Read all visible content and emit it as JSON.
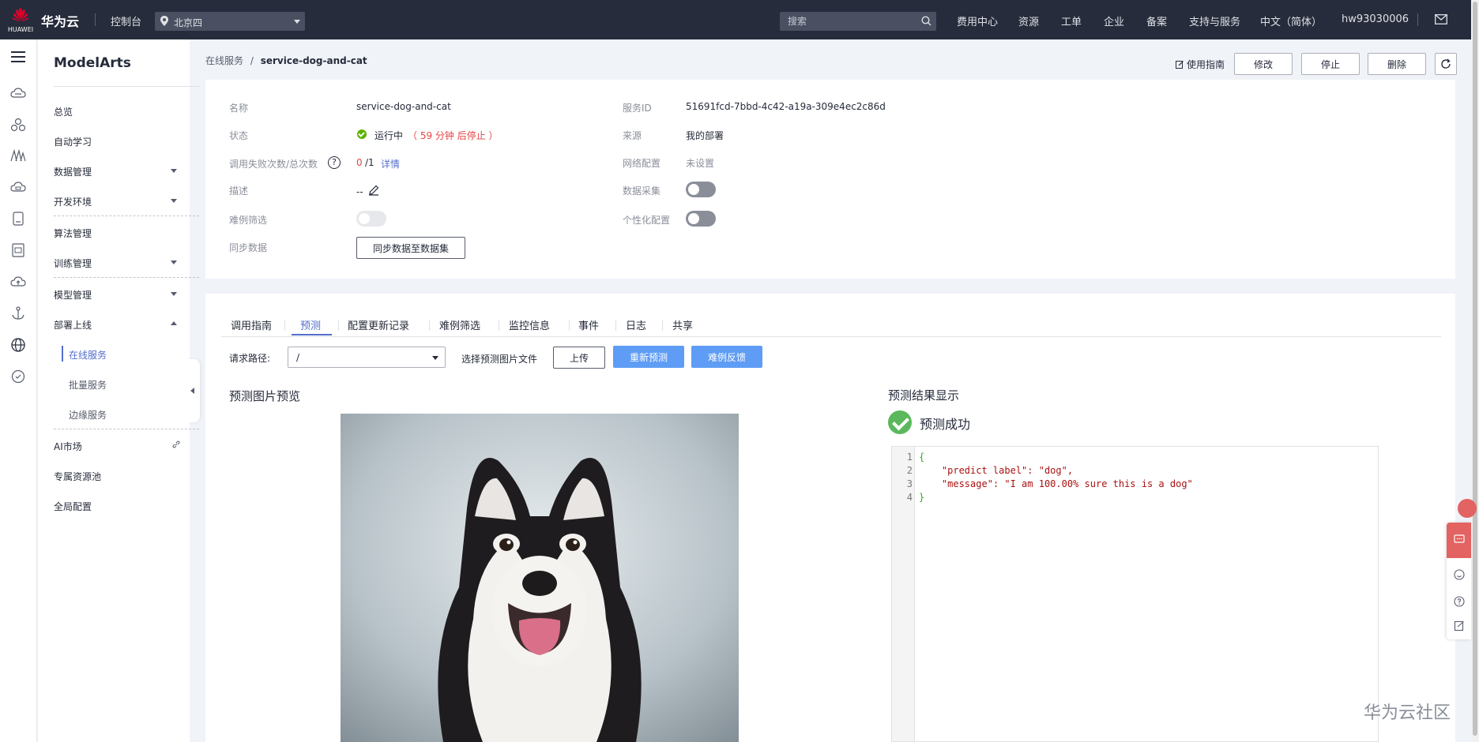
{
  "topbar": {
    "logo_text": "HUAWEI",
    "brand": "华为云",
    "console": "控制台",
    "region": "北京四",
    "search_placeholder": "搜索",
    "nav": [
      "费用中心",
      "资源",
      "工单",
      "企业",
      "备案",
      "支持与服务",
      "中文（简体）",
      "hw93030006"
    ]
  },
  "sidebar": {
    "title": "ModelArts",
    "items": [
      "总览",
      "自动学习",
      "数据管理",
      "开发环境",
      "算法管理",
      "训练管理",
      "模型管理",
      "部署上线"
    ],
    "sub_items": [
      "在线服务",
      "批量服务",
      "边缘服务"
    ],
    "bottom_items": [
      "AI市场",
      "专属资源池",
      "全局配置"
    ]
  },
  "breadcrumb": {
    "parent": "在线服务",
    "separator": "/",
    "current": "service-dog-and-cat"
  },
  "header_actions": {
    "guide": "使用指南",
    "modify": "修改",
    "stop": "停止",
    "delete": "删除"
  },
  "details": {
    "name_label": "名称",
    "name_value": "service-dog-and-cat",
    "status_label": "状态",
    "status_value": "运行中",
    "status_remaining": "（ 59 分钟 后停止 ）",
    "calls_label": "调用失败次数/总次数",
    "calls_failed": "0",
    "calls_total": "/1",
    "calls_detail": "详情",
    "desc_label": "描述",
    "desc_value": "--",
    "hard_label": "难例筛选",
    "sync_label": "同步数据",
    "sync_button": "同步数据至数据集",
    "service_id_label": "服务ID",
    "service_id_value": "51691fcd-7bbd-4c42-a19a-309e4ec2c86d",
    "source_label": "来源",
    "source_value": "我的部署",
    "network_label": "网络配置",
    "network_value": "未设置",
    "collect_label": "数据采集",
    "personal_label": "个性化配置"
  },
  "tabs": [
    "调用指南",
    "预测",
    "配置更新记录",
    "难例筛选",
    "监控信息",
    "事件",
    "日志",
    "共享"
  ],
  "predict": {
    "path_label": "请求路径:",
    "path_value": "/",
    "file_label": "选择预测图片文件",
    "upload": "上传",
    "predict_button": "重新预测",
    "feedback_button": "难例反馈",
    "preview_title": "预测图片预览",
    "result_title": "预测结果显示",
    "success_text": "预测成功",
    "code_lines": [
      "{",
      "    \"predict label\": \"dog\",",
      "    \"message\": \"I am 100.00% sure this is a dog\"",
      "}"
    ],
    "line_numbers": [
      "1",
      "2",
      "3",
      "4"
    ]
  },
  "watermark": "华为云社区",
  "colors": {
    "topbar": "#262c3b",
    "accent": "#526ecc",
    "primary_button": "#5e9cf5",
    "danger": "#e54545",
    "success": "#5cb300"
  }
}
